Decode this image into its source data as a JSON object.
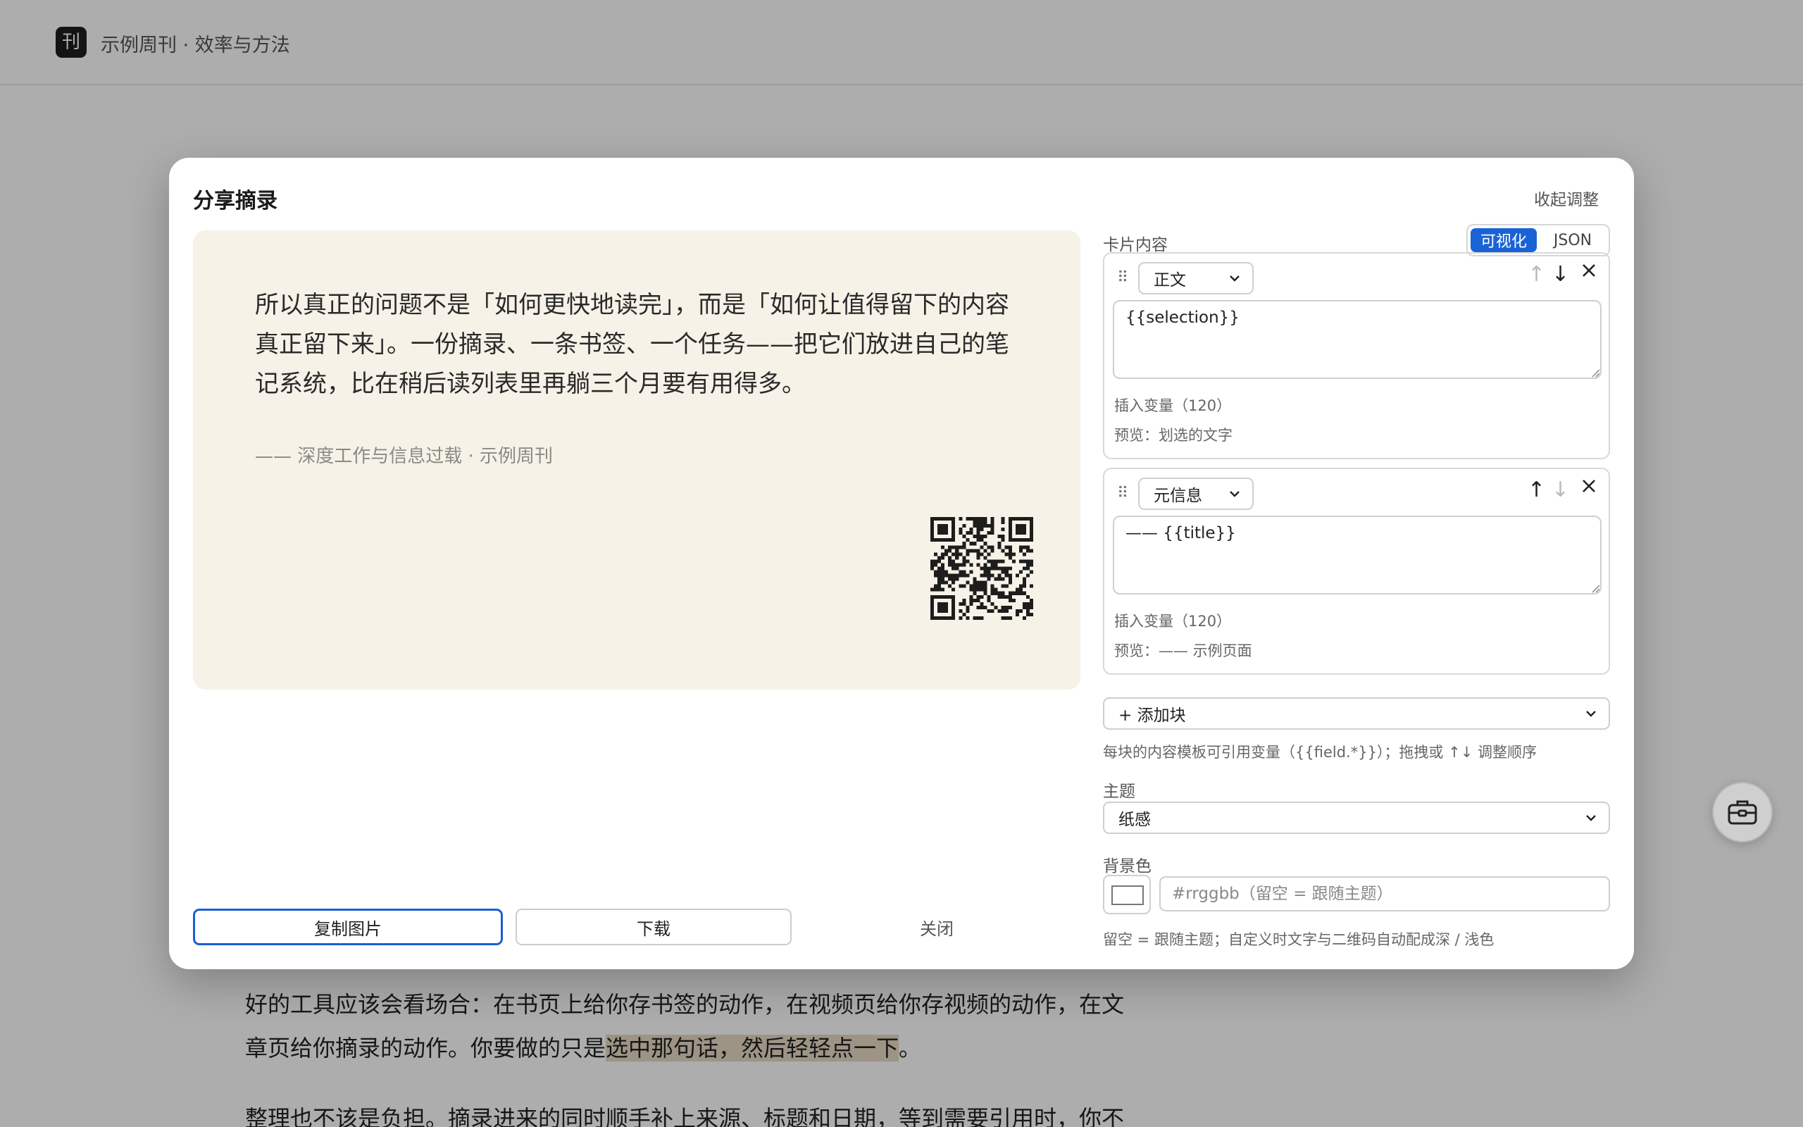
{
  "site": {
    "logo_char": "刊",
    "title": "示例周刊 · 效率与方法"
  },
  "article": {
    "paragraph1_before": "好的工具应该会看场合：在书页上给你存书签的动作，在视频页给你存视频的动作，在文章页给你摘录的动作。你要做的只是",
    "paragraph1_highlight": "选中那句话，然后轻轻点一下",
    "paragraph1_after": "。",
    "paragraph2": "整理也不该是负担。摘录进来的同时顺手补上来源、标题和日期，等到需要引用时，你不"
  },
  "modal": {
    "title": "分享摘录",
    "collapse_label": "收起调整",
    "preview": {
      "quote": "所以真正的问题不是「如何更快地读完」，而是「如何让值得留下的内容真正留下来」。一份摘录、一条书签、一个任务——把它们放进自己的笔记系统，比在稍后读列表里再躺三个月要有用得多。",
      "meta": "—— 深度工作与信息过载 · 示例周刊"
    },
    "buttons": {
      "copy": "复制图片",
      "download": "下载",
      "close": "关闭"
    },
    "panel": {
      "label": "卡片内容",
      "mode_visual": "可视化",
      "mode_json": "JSON",
      "blocks": [
        {
          "type": "正文",
          "template": "{{selection}}",
          "insert_var": "插入变量（120）",
          "preview": "预览：划选的文字"
        },
        {
          "type": "元信息",
          "template": "—— {{title}}",
          "insert_var": "插入变量（120）",
          "preview": "预览：—— 示例页面"
        }
      ],
      "add_block": "+ 添加块",
      "help": "每块的内容模板可引用变量（{{field.*}}）；拖拽或 ↑↓ 调整顺序",
      "theme_label": "主题",
      "theme_value": "纸感",
      "bg_label": "背景色",
      "bg_placeholder": "#rrggbb（留空 = 跟随主题）",
      "bg_help": "留空 = 跟随主题；自定义时文字与二维码自动配成深 / 浅色"
    }
  },
  "colors": {
    "accent": "#1a63d6",
    "card_bg": "#f6f2e7",
    "highlight": "#d6be96"
  }
}
